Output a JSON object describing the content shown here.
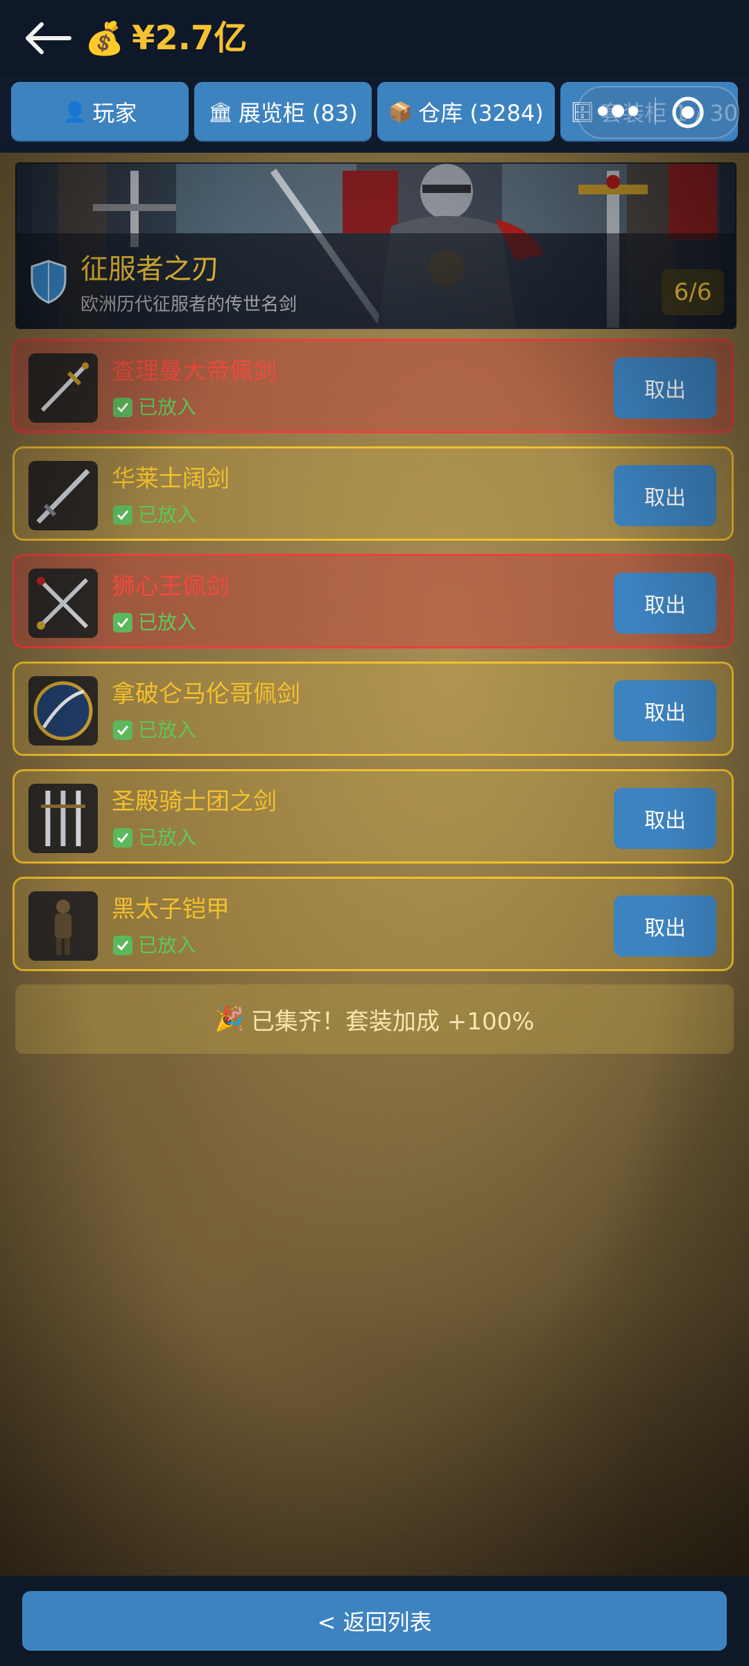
{
  "header": {
    "money": "¥2.7亿",
    "money_icon": "money-bag-icon"
  },
  "tabs": [
    {
      "icon": "👤",
      "label": "玩家"
    },
    {
      "icon": "🏛",
      "label": "展览柜 (83)"
    },
    {
      "icon": "📦",
      "label": "仓库 (3284)"
    },
    {
      "icon": "🗄",
      "label": "套装柜 1 / 30"
    }
  ],
  "set": {
    "title": "征服者之刃",
    "subtitle": "欧洲历代征服者的传世名剑",
    "count": "6/6"
  },
  "items": [
    {
      "name": "查理曼大帝佩剑",
      "status": "已放入",
      "button": "取出",
      "rarity": "red"
    },
    {
      "name": "华莱士阔剑",
      "status": "已放入",
      "button": "取出",
      "rarity": "gold"
    },
    {
      "name": "狮心王佩剑",
      "status": "已放入",
      "button": "取出",
      "rarity": "red"
    },
    {
      "name": "拿破仑马伦哥佩剑",
      "status": "已放入",
      "button": "取出",
      "rarity": "gold"
    },
    {
      "name": "圣殿骑士团之剑",
      "status": "已放入",
      "button": "取出",
      "rarity": "gold"
    },
    {
      "name": "黑太子铠甲",
      "status": "已放入",
      "button": "取出",
      "rarity": "gold"
    }
  ],
  "completion": {
    "icon": "🎉",
    "text": "已集齐！套装加成 +100%"
  },
  "footer": {
    "return_label": "< 返回列表"
  },
  "colors": {
    "gold": "#f2c12e",
    "red": "#ef3d3d",
    "button": "#3d83c0",
    "status": "#5cc85c"
  }
}
